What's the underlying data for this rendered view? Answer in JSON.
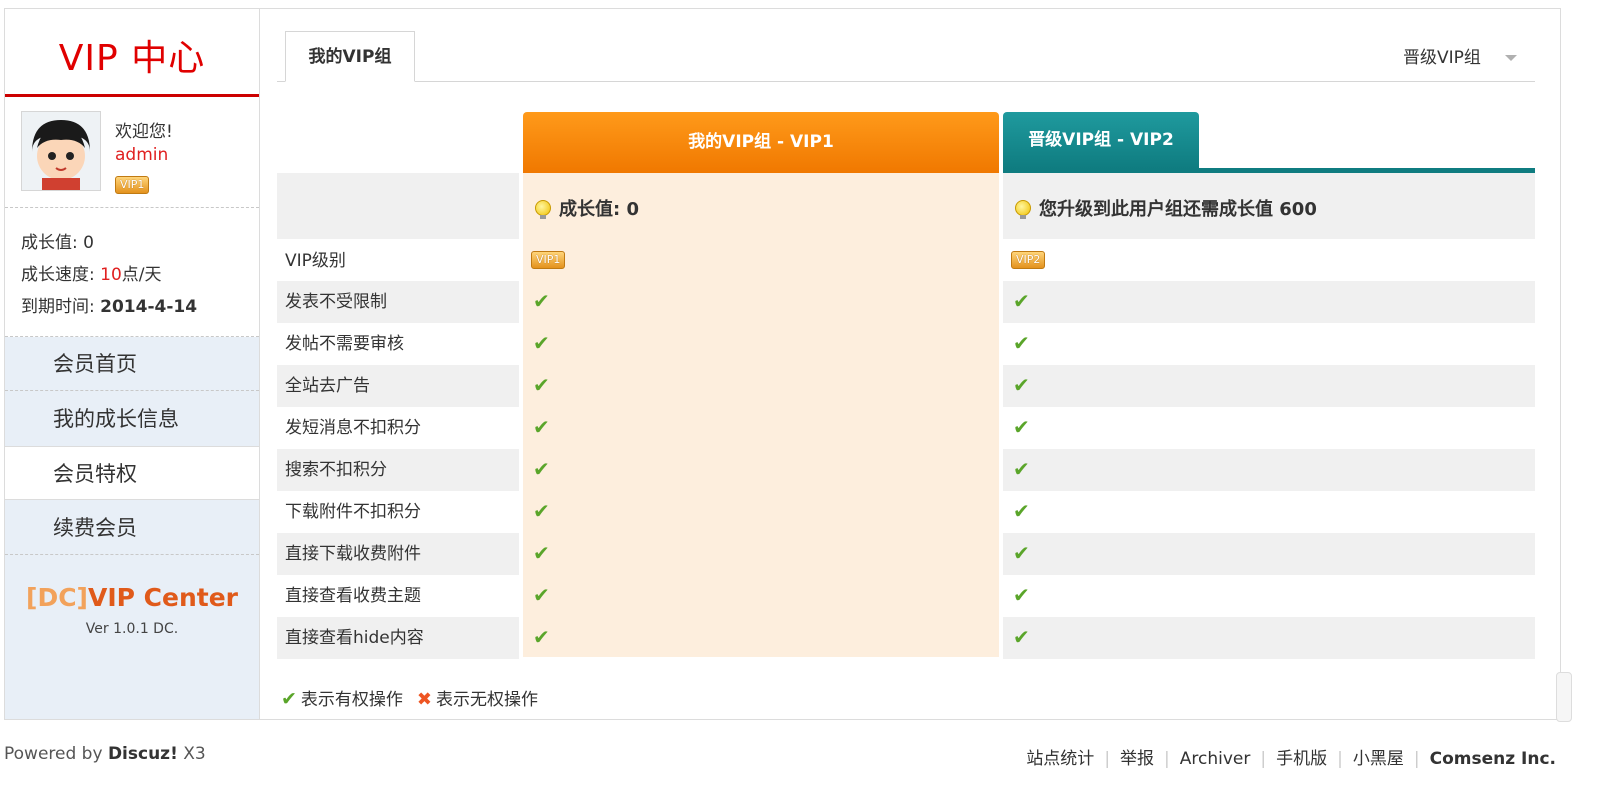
{
  "sidebar": {
    "title": "VIP 中心",
    "welcome": "欢迎您!",
    "username": "admin",
    "vip_badge": "VIP1",
    "growth_label": "成长值: ",
    "growth_value": "0",
    "speed_label": "成长速度: ",
    "speed_value": "10",
    "speed_unit": "点/天",
    "expire_label": "到期时间: ",
    "expire_value": "2014-4-14",
    "nav": [
      {
        "label": "会员首页"
      },
      {
        "label": "我的成长信息"
      },
      {
        "label": "会员特权"
      },
      {
        "label": "续费会员"
      }
    ],
    "brand_prefix": "[DC]",
    "brand_name": "VIP Center",
    "brand_version": "Ver 1.0.1 DC."
  },
  "tabs": {
    "active": "我的VIP组",
    "upgrade_link": "晋级VIP组"
  },
  "table": {
    "col1_header": "我的VIP组 - VIP1",
    "col2_header": "晋级VIP组 - VIP2",
    "col1_growth": "成长值: 0",
    "col2_growth": "您升级到此用户组还需成长值 600",
    "vip_level_label": "VIP级别",
    "col1_badge": "VIP1",
    "col2_badge": "VIP2",
    "privileges": [
      {
        "label": "发表不受限制",
        "col1": "✔",
        "col2": "✔"
      },
      {
        "label": "发帖不需要审核",
        "col1": "✔",
        "col2": "✔"
      },
      {
        "label": "全站去广告",
        "col1": "✔",
        "col2": "✔"
      },
      {
        "label": "发短消息不扣积分",
        "col1": "✔",
        "col2": "✔"
      },
      {
        "label": "搜索不扣积分",
        "col1": "✔",
        "col2": "✔"
      },
      {
        "label": "下载附件不扣积分",
        "col1": "✔",
        "col2": "✔"
      },
      {
        "label": "直接下载收费附件",
        "col1": "✔",
        "col2": "✔"
      },
      {
        "label": "直接查看收费主题",
        "col1": "✔",
        "col2": "✔"
      },
      {
        "label": "直接查看hide内容",
        "col1": "✔",
        "col2": "✔"
      }
    ]
  },
  "legend": {
    "check_symbol": "✔",
    "check_text": "表示有权操作",
    "cross_symbol": "✖",
    "cross_text": "表示无权操作"
  },
  "footer": {
    "powered_prefix": "Powered by ",
    "powered_brand": "Discuz!",
    "powered_version": " X3",
    "links": [
      "站点统计",
      "举报",
      "Archiver",
      "手机版",
      "小黑屋"
    ],
    "company": "Comsenz Inc."
  },
  "colors": {
    "title_red": "#e00000",
    "orange_header": "#f07800",
    "teal_header": "#0f7c80",
    "check_green": "#5aa52a",
    "cross_red": "#ee5522"
  }
}
